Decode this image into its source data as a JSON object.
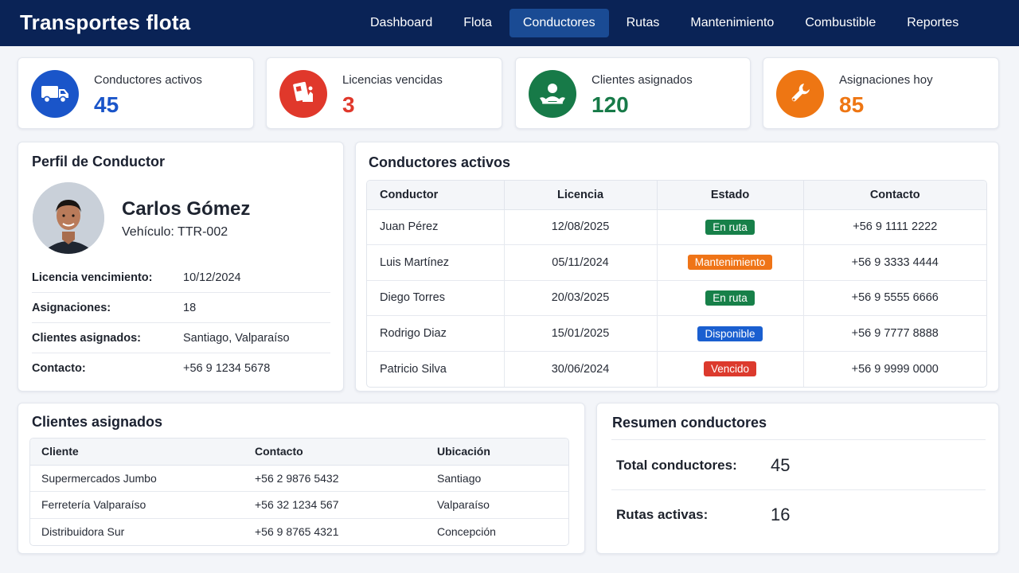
{
  "app": {
    "title": "Transportes flota"
  },
  "nav": [
    {
      "label": "Dashboard",
      "active": false
    },
    {
      "label": "Flota",
      "active": false
    },
    {
      "label": "Conductores",
      "active": true
    },
    {
      "label": "Rutas",
      "active": false
    },
    {
      "label": "Mantenimiento",
      "active": false
    },
    {
      "label": "Combustible",
      "active": false
    },
    {
      "label": "Reportes",
      "active": false
    }
  ],
  "stats": [
    {
      "label": "Conductores activos",
      "value": "45",
      "color": "#1a55c9",
      "icon": "truck-icon"
    },
    {
      "label": "Licencias vencidas",
      "value": "3",
      "color": "#e0382b",
      "icon": "license-icon"
    },
    {
      "label": "Clientes asignados",
      "value": "120",
      "color": "#177a48",
      "icon": "clients-icon"
    },
    {
      "label": "Asignaciones hoy",
      "value": "85",
      "color": "#ee7613",
      "icon": "wrench-icon"
    }
  ],
  "profile": {
    "title": "Perfil de Conductor",
    "name": "Carlos Gómez",
    "vehicle": "Vehículo: TTR-002",
    "rows": [
      {
        "key": "Licencia vencimiento:",
        "value": "10/12/2024"
      },
      {
        "key": "Asignaciones:",
        "value": "18"
      },
      {
        "key": "Clientes asignados:",
        "value": "Santiago, Valparaíso"
      },
      {
        "key": "Contacto:",
        "value": "+56 9 1234 5678"
      }
    ]
  },
  "drivers": {
    "title": "Conductores activos",
    "headers": [
      "Conductor",
      "Licencia",
      "Estado",
      "Contacto"
    ],
    "rows": [
      {
        "name": "Juan Pérez",
        "license": "12/08/2025",
        "status": "En ruta",
        "status_color": "#178049",
        "contact": "+56 9 1111 2222"
      },
      {
        "name": "Luis Martínez",
        "license": "05/11/2024",
        "status": "Mantenimiento",
        "status_color": "#ef7417",
        "contact": "+56 9 3333 4444"
      },
      {
        "name": "Diego Torres",
        "license": "20/03/2025",
        "status": "En ruta",
        "status_color": "#178049",
        "contact": "+56 9 5555 6666"
      },
      {
        "name": "Rodrigo Diaz",
        "license": "15/01/2025",
        "status": "Disponible",
        "status_color": "#1a5fd0",
        "contact": "+56 9 7777 8888"
      },
      {
        "name": "Patricio Silva",
        "license": "30/06/2024",
        "status": "Vencido",
        "status_color": "#dc3a2d",
        "contact": "+56 9 9999 0000"
      }
    ]
  },
  "clients": {
    "title": "Clientes asignados",
    "headers": [
      "Cliente",
      "Contacto",
      "Ubicación"
    ],
    "rows": [
      {
        "client": "Supermercados Jumbo",
        "contact": "+56 2 9876 5432",
        "location": "Santiago"
      },
      {
        "client": "Ferretería Valparaíso",
        "contact": "+56 32 1234 567",
        "location": "Valparaíso"
      },
      {
        "client": "Distribuidora Sur",
        "contact": "+56 9 8765 4321",
        "location": "Concepción"
      }
    ]
  },
  "summary": {
    "title": "Resumen conductores",
    "rows": [
      {
        "key": "Total conductores:",
        "value": "45"
      },
      {
        "key": "Rutas activas:",
        "value": "16"
      }
    ]
  }
}
